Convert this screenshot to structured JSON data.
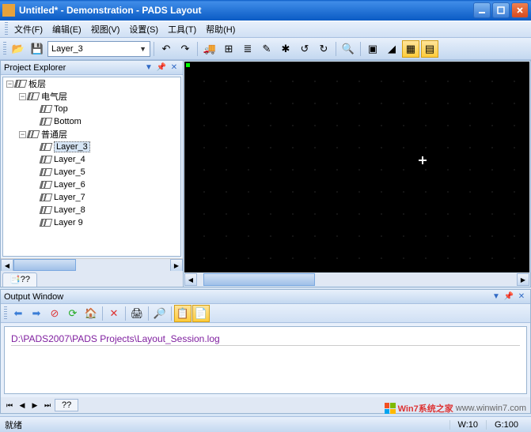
{
  "window": {
    "title": "Untitled* - Demonstration - PADS Layout"
  },
  "menu": {
    "file": "文件(F)",
    "edit": "编辑(E)",
    "view": "视图(V)",
    "setup": "设置(S)",
    "tools": "工具(T)",
    "help": "帮助(H)"
  },
  "toolbar": {
    "layer_value": "Layer_3"
  },
  "project_explorer": {
    "title": "Project Explorer",
    "root": "板层",
    "elec_group": "电气层",
    "elec_layers": [
      "Top",
      "Bottom"
    ],
    "general_group": "普通层",
    "general_layers": [
      "Layer_3",
      "Layer_4",
      "Layer_5",
      "Layer_6",
      "Layer_7",
      "Layer_8",
      "Layer 9"
    ],
    "selected": "Layer_3",
    "tab": "??"
  },
  "output": {
    "title": "Output Window",
    "log_line": "D:\\PADS2007\\PADS Projects\\Layout_Session.log",
    "tab": "??"
  },
  "status": {
    "ready": "就绪",
    "w": "W:10",
    "g": "G:100"
  },
  "watermark": {
    "brand": "Win7系统之家",
    "url": "www.winwin7.com"
  }
}
